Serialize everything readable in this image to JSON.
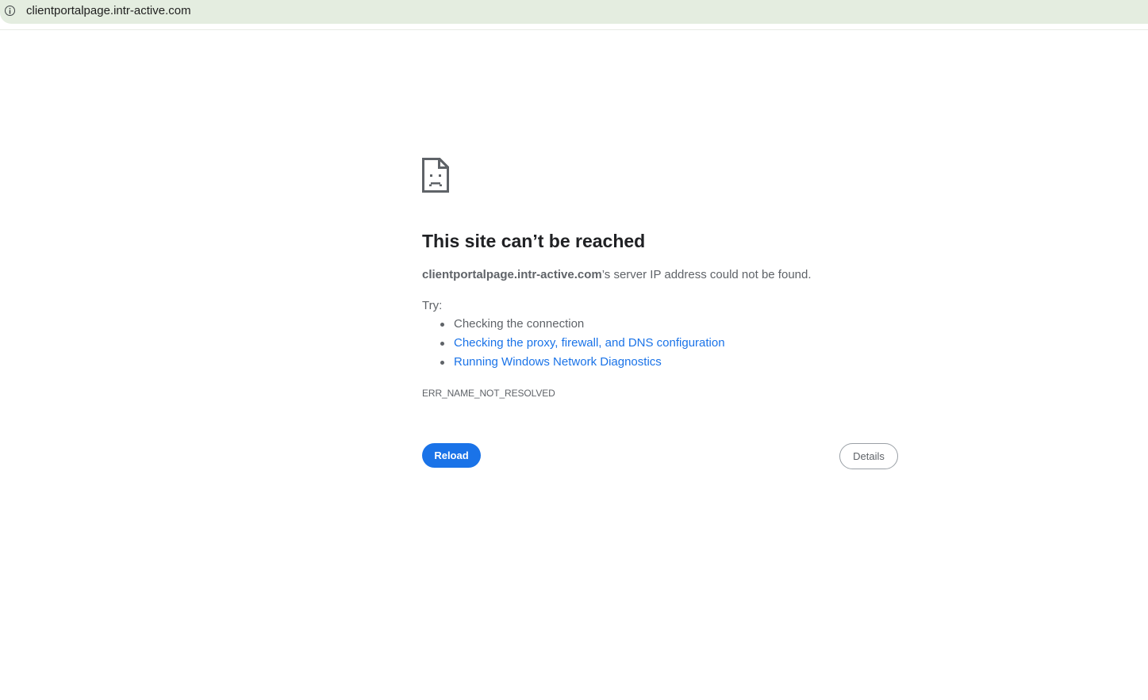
{
  "address_bar": {
    "url": "clientportalpage.intr-active.com",
    "icon": "info-icon"
  },
  "error_page": {
    "icon": "sad-page-icon",
    "heading": "This site can’t be reached",
    "host": "clientportalpage.intr-active.com",
    "message_suffix": "’s server IP address could not be found.",
    "try_label": "Try:",
    "suggestions": [
      {
        "label": "Checking the connection",
        "link": false
      },
      {
        "label": "Checking the proxy, firewall, and DNS configuration",
        "link": true
      },
      {
        "label": "Running Windows Network Diagnostics",
        "link": true
      }
    ],
    "error_code": "ERR_NAME_NOT_RESOLVED",
    "reload_label": "Reload",
    "details_label": "Details"
  },
  "colors": {
    "address_bar_bg": "#e4ede0",
    "link": "#1a73e8",
    "primary_button": "#1a73e8",
    "text_secondary": "#5f6368",
    "heading": "#202124"
  }
}
